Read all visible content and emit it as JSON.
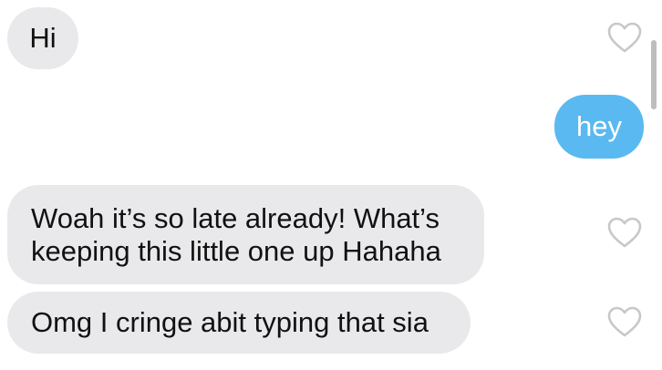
{
  "conversation": {
    "messages": [
      {
        "direction": "received",
        "text": "Hi",
        "liked": false
      },
      {
        "direction": "sent",
        "text": "hey"
      },
      {
        "direction": "received",
        "lines": [
          "Woah it’s so late already! What’s",
          "keeping this little one up Hahaha"
        ],
        "liked": false
      },
      {
        "direction": "received",
        "text": "Omg I cringe abit typing that sia",
        "liked": false
      }
    ]
  },
  "colors": {
    "received_bubble": "#e9e9eb",
    "sent_bubble": "#5ab9f0",
    "heart_outline": "#c8c8cc"
  },
  "icons": {
    "like": "heart-outline-icon"
  }
}
